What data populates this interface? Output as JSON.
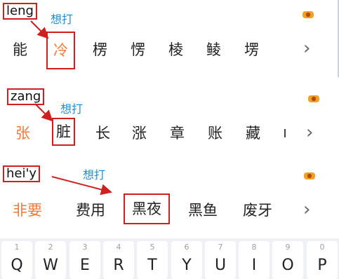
{
  "rows": [
    {
      "pinyin": "leng",
      "note": "想打",
      "candidates": [
        "能",
        "冷",
        "楞",
        "愣",
        "棱",
        "鲮",
        "塄"
      ]
    },
    {
      "pinyin": "zang",
      "note": "想打",
      "candidates": [
        "张",
        "脏",
        "长",
        "涨",
        "章",
        "账",
        "藏"
      ]
    },
    {
      "pinyin": "hei'y",
      "note": "想打",
      "candidates": [
        "非要",
        "费用",
        "黑夜",
        "黑鱼",
        "废牙"
      ]
    }
  ],
  "chevron": "›",
  "keyboard": {
    "keys": [
      {
        "num": "1",
        "letter": "Q"
      },
      {
        "num": "2",
        "letter": "W"
      },
      {
        "num": "3",
        "letter": "E"
      },
      {
        "num": "4",
        "letter": "R"
      },
      {
        "num": "5",
        "letter": "T"
      },
      {
        "num": "6",
        "letter": "Y"
      },
      {
        "num": "7",
        "letter": "U"
      },
      {
        "num": "8",
        "letter": "I"
      },
      {
        "num": "9",
        "letter": "O"
      },
      {
        "num": "0",
        "letter": "P"
      }
    ]
  },
  "colors": {
    "annotation_box": "#d01f1f",
    "note_text": "#1f8fd8",
    "first_candidate": "#f07a3a",
    "mic_icon": "#f4a020"
  }
}
